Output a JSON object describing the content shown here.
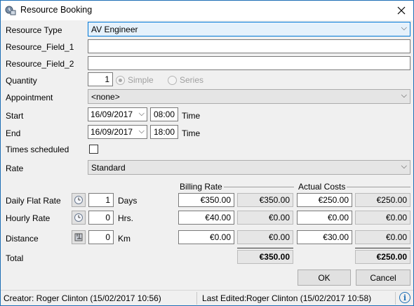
{
  "window": {
    "title": "Resource Booking"
  },
  "labels": {
    "resource_type": "Resource Type",
    "field1": "Resource_Field_1",
    "field2": "Resource_Field_2",
    "quantity": "Quantity",
    "appointment": "Appointment",
    "start": "Start",
    "end": "End",
    "times_scheduled": "Times scheduled",
    "rate": "Rate",
    "daily_flat_rate": "Daily Flat Rate",
    "hourly_rate": "Hourly Rate",
    "distance": "Distance",
    "total": "Total",
    "time": "Time",
    "days": "Days",
    "hrs": "Hrs.",
    "km": "Km"
  },
  "form": {
    "resource_type": "AV Engineer",
    "field1": "",
    "field2": "",
    "quantity": "1",
    "simple_label": "Simple",
    "series_label": "Series",
    "appointment": "<none>",
    "start_date": "16/09/2017",
    "start_time": "08:00",
    "end_date": "16/09/2017",
    "end_time": "18:00",
    "times_scheduled_checked": false,
    "rate": "Standard"
  },
  "billing": {
    "billing_rate_header": "Billing Rate",
    "actual_costs_header": "Actual Costs",
    "daily": {
      "qty": "1",
      "billing_rate": "€350.00",
      "billing_total": "€350.00",
      "actual_rate": "€250.00",
      "actual_total": "€250.00"
    },
    "hourly": {
      "qty": "0",
      "billing_rate": "€40.00",
      "billing_total": "€0.00",
      "actual_rate": "€0.00",
      "actual_total": "€0.00"
    },
    "distance": {
      "qty": "0",
      "billing_rate": "€0.00",
      "billing_total": "€0.00",
      "actual_rate": "€30.00",
      "actual_total": "€0.00"
    },
    "total_billing": "€350.00",
    "total_actual": "€250.00"
  },
  "buttons": {
    "ok": "OK",
    "cancel": "Cancel"
  },
  "status": {
    "creator": "Creator: Roger Clinton (15/02/2017 10:56)",
    "last_edited_label": "Last Edited:",
    "last_edited": "Roger Clinton (15/02/2017 10:58)"
  },
  "icons": [
    "resource-booking-icon",
    "close-icon",
    "chevron-down-icon",
    "clock-icon",
    "ruler-icon",
    "info-icon"
  ]
}
